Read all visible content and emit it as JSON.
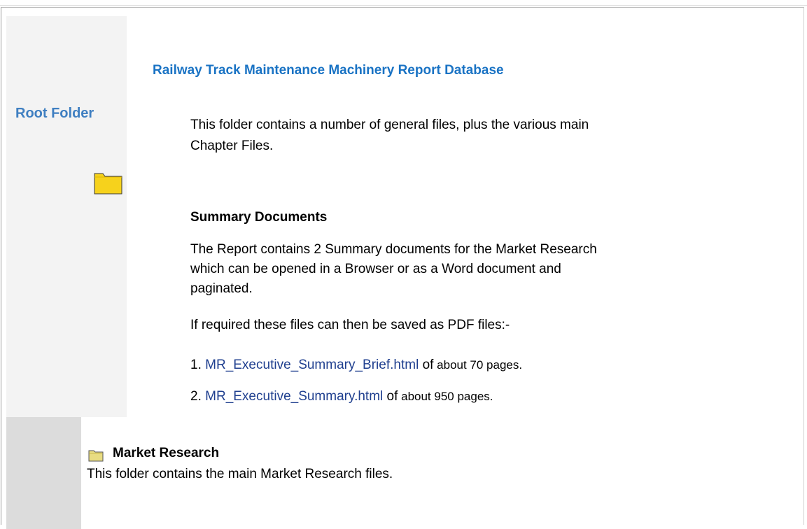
{
  "sidebar": {
    "root_label": "Root Folder",
    "root_icon": "folder-icon"
  },
  "main": {
    "title": "Railway Track Maintenance Machinery Report Database",
    "intro": "This folder contains a number of general files, plus the various main Chapter Files.",
    "summary_heading": "Summary Documents",
    "summary_text": "The Report contains 2 Summary documents for the Market Research which can be opened in a Browser or as a Word document and paginated.",
    "pdf_text": "If required these files can then be saved as PDF files:-",
    "files": [
      {
        "num": "1.",
        "link": "MR_Executive_Summary_Brief.html",
        "tail_of": "of",
        "tail_rest": " about 70 pages."
      },
      {
        "num": "2.",
        "link": "MR_Executive_Summary.html",
        "tail_of": "of",
        "tail_rest": " about 950 pages."
      }
    ]
  },
  "market_research": {
    "icon": "folder-icon",
    "heading": "Market Research",
    "text": "This folder contains the main Market Research files."
  },
  "colors": {
    "title": "#1a73c4",
    "root_label": "#3f7fc1",
    "link": "#1f3f8f",
    "sidebar_light": "#f3f3f3",
    "sidebar_dark": "#dcdcdc",
    "folder": "#f6d21c"
  }
}
